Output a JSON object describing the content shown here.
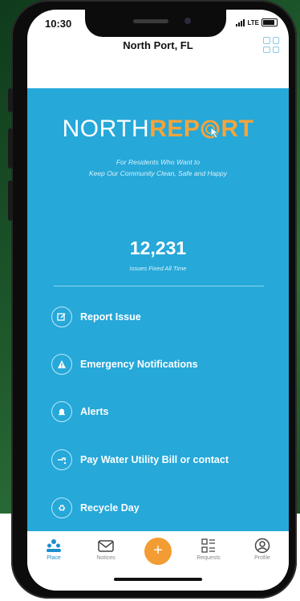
{
  "status": {
    "time": "10:30",
    "network": "LTE"
  },
  "header": {
    "title": "North Port, FL"
  },
  "logo": {
    "part1": "NORTH",
    "part2": "REP",
    "part3": "RT"
  },
  "tagline": [
    "For Residents Who Want to",
    "Keep Our Community Clean, Safe and Happy"
  ],
  "stat": {
    "value": "12,231",
    "label": "Issues Fixed All Time"
  },
  "menu": [
    {
      "label": "Report Issue",
      "icon": "edit-icon"
    },
    {
      "label": "Emergency Notifications",
      "icon": "warning-icon"
    },
    {
      "label": "Alerts",
      "icon": "bell-icon"
    },
    {
      "label": "Pay Water Utility Bill or contact",
      "icon": "water-tap-icon"
    },
    {
      "label": "Recycle Day",
      "icon": "recycle-icon"
    }
  ],
  "tabs": [
    {
      "label": "Place",
      "icon": "people-icon",
      "active": true
    },
    {
      "label": "Notices",
      "icon": "mail-icon"
    },
    {
      "label": "Requests",
      "icon": "list-icon"
    },
    {
      "label": "Profile",
      "icon": "user-icon"
    }
  ],
  "colors": {
    "primary": "#26a8d9",
    "accent": "#f6a43b",
    "fab": "#f39c33"
  }
}
